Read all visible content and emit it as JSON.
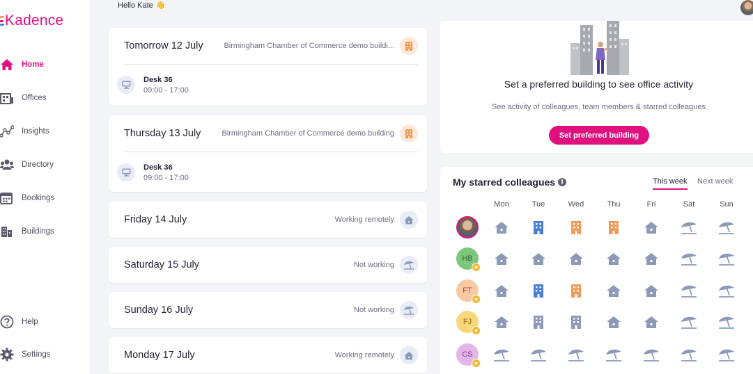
{
  "app": {
    "logo_text": "Kadence",
    "brand_color": "#e0117f"
  },
  "header": {
    "greeting": "Hello Kate",
    "wave_emoji": "👋"
  },
  "sidebar": {
    "items": [
      {
        "label": "Home",
        "icon": "home-icon",
        "active": true
      },
      {
        "label": "Offices",
        "icon": "offices-icon",
        "active": false
      },
      {
        "label": "Insights",
        "icon": "insights-icon",
        "active": false
      },
      {
        "label": "Directory",
        "icon": "directory-icon",
        "active": false
      },
      {
        "label": "Bookings",
        "icon": "bookings-icon",
        "active": false
      },
      {
        "label": "Buildings",
        "icon": "buildings-icon",
        "active": false
      }
    ],
    "bottom_items": [
      {
        "label": "Help",
        "icon": "help-icon"
      },
      {
        "label": "Settings",
        "icon": "settings-icon"
      }
    ]
  },
  "schedule": [
    {
      "dow": "Tomorrow",
      "date": "12 July",
      "location": "Birmingham Chamber of Commerce demo buildi...",
      "status_icon": "office-building-icon",
      "booking": {
        "desk": "Desk 36",
        "time": "09:00 - 17:00"
      }
    },
    {
      "dow": "Thursday",
      "date": "13 July",
      "location": "Birmingham Chamber of Commerce demo building",
      "status_icon": "office-building-icon",
      "booking": {
        "desk": "Desk 36",
        "time": "09:00 - 17:00"
      }
    },
    {
      "dow": "Friday",
      "date": "14 July",
      "location": "Working remotely",
      "status_icon": "home-remote-icon"
    },
    {
      "dow": "Saturday",
      "date": "15 July",
      "location": "Not working",
      "status_icon": "beach-umbrella-icon"
    },
    {
      "dow": "Sunday",
      "date": "16 July",
      "location": "Not working",
      "status_icon": "beach-umbrella-icon"
    },
    {
      "dow": "Monday",
      "date": "17 July",
      "location": "Working remotely",
      "status_icon": "home-remote-icon"
    }
  ],
  "preferred": {
    "title": "Set a preferred building to see office activity",
    "subtitle": "See activity of colleagues, team members & starred colleagues",
    "button": "Set preferred building"
  },
  "starred": {
    "title": "My starred colleagues",
    "tabs": [
      "This week",
      "Next week"
    ],
    "active_tab": "This week",
    "days": [
      "Mon",
      "Tue",
      "Wed",
      "Thu",
      "Fri",
      "Sat",
      "Sun"
    ],
    "colleagues": [
      {
        "initials": "",
        "photo": true,
        "starred": false,
        "week": [
          "remote",
          "office-blue",
          "office-orange",
          "office-orange",
          "remote",
          "off",
          "off"
        ]
      },
      {
        "initials": "HB",
        "avatar_bg": "#7cc77b",
        "text_color": "#2f6a2e",
        "starred": true,
        "week": [
          "remote",
          "remote",
          "remote",
          "remote",
          "remote",
          "off",
          "off"
        ]
      },
      {
        "initials": "FT",
        "avatar_bg": "#f9c9a4",
        "text_color": "#9b5420",
        "starred": true,
        "week": [
          "remote",
          "office-blue",
          "office-orange",
          "remote",
          "remote",
          "off",
          "off"
        ]
      },
      {
        "initials": "FJ",
        "avatar_bg": "#f7d77a",
        "text_color": "#8a6a10",
        "starred": true,
        "week": [
          "remote",
          "office-grey",
          "office-grey",
          "remote",
          "remote",
          "off",
          "off"
        ]
      },
      {
        "initials": "CS",
        "avatar_bg": "#e4b5e8",
        "text_color": "#7a3a82",
        "starred": true,
        "week": [
          "off",
          "off",
          "off",
          "off",
          "off",
          "off",
          "off"
        ]
      }
    ]
  },
  "colors": {
    "remote": "#8c9ab8",
    "office_blue": "#4a7fd6",
    "office_orange": "#f29a55",
    "office_grey": "#8c9ab8",
    "off": "#8c9ab8"
  }
}
